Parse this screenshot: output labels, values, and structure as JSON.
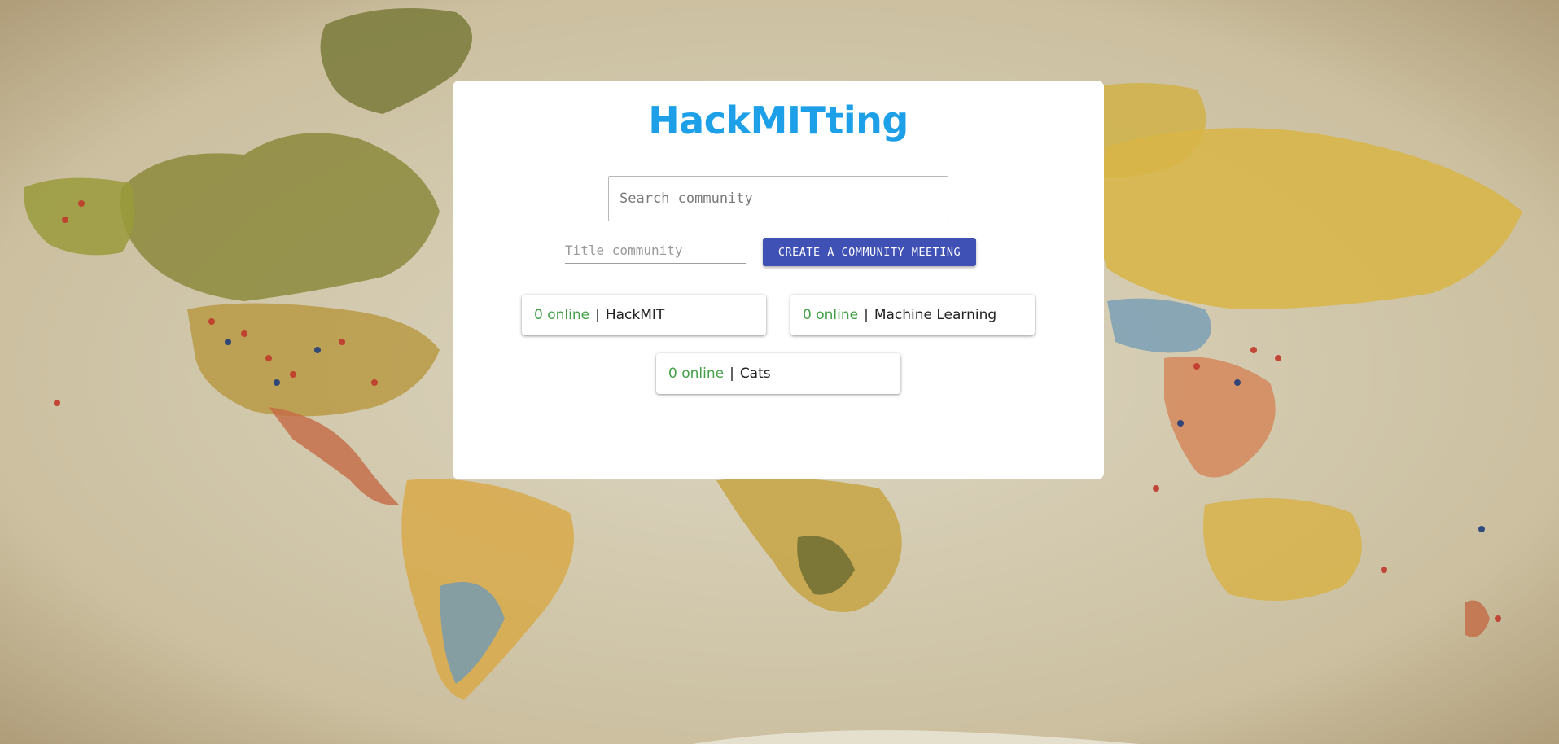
{
  "app": {
    "title": "HackMITting"
  },
  "search": {
    "placeholder": "Search community",
    "value": ""
  },
  "create": {
    "title_placeholder": "Title community",
    "title_value": "",
    "button_label": "CREATE A COMMUNITY MEETING"
  },
  "communities": [
    {
      "online": "0 online",
      "separator": "|",
      "name": "HackMIT"
    },
    {
      "online": "0 online",
      "separator": "|",
      "name": "Machine Learning"
    },
    {
      "online": "0 online",
      "separator": "|",
      "name": "Cats"
    }
  ],
  "colors": {
    "title": "#1ea0e8",
    "button": "#3f51b5",
    "online": "#43a047"
  },
  "background": {
    "icon": "world-map-background"
  }
}
